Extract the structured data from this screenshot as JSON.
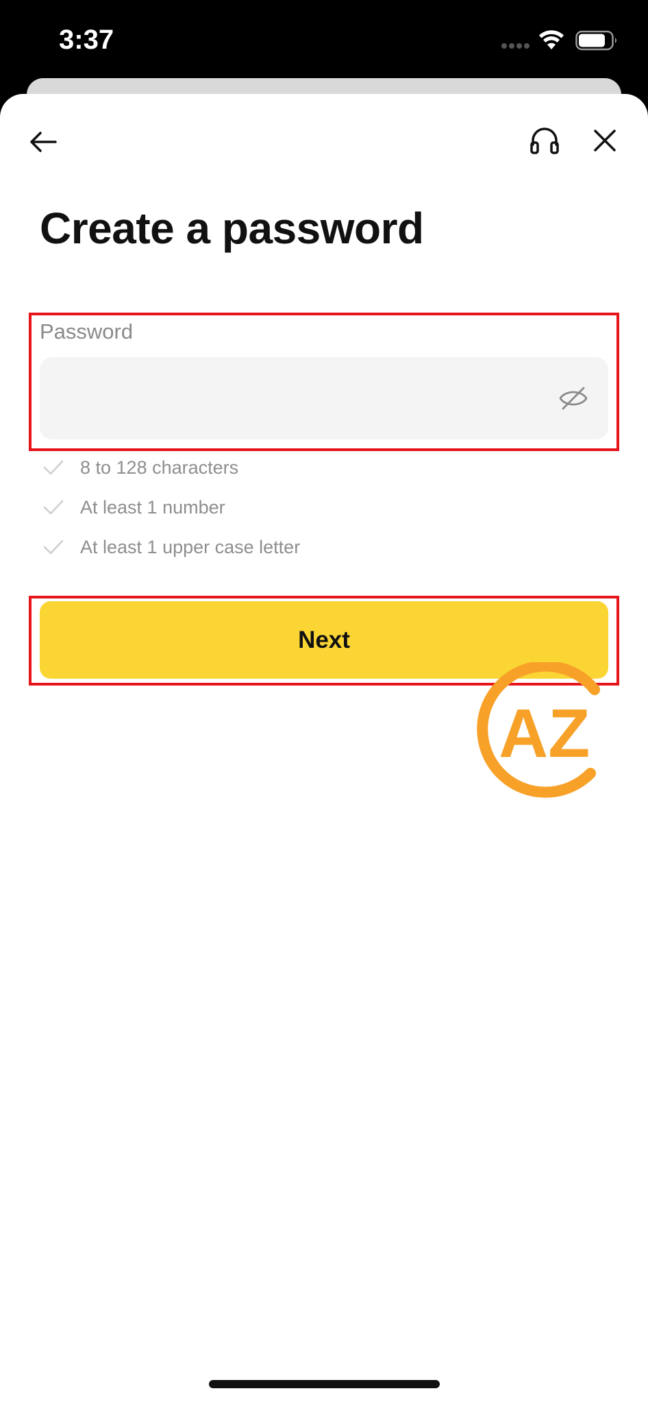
{
  "status_bar": {
    "time": "3:37"
  },
  "nav": {
    "back_icon": "arrow-left-icon",
    "support_icon": "headset-icon",
    "close_icon": "close-icon"
  },
  "title": "Create a password",
  "password_field": {
    "label": "Password",
    "value": "",
    "placeholder": "",
    "visibility_icon": "eye-off-icon"
  },
  "requirements": [
    {
      "text": "8 to 128 characters",
      "met": false
    },
    {
      "text": "At least 1 number",
      "met": false
    },
    {
      "text": "At least 1 upper case letter",
      "met": false
    }
  ],
  "next_button": {
    "label": "Next"
  },
  "watermark": {
    "text": "AZ"
  },
  "colors": {
    "accent": "#fad534",
    "highlight": "#e8141c",
    "watermark": "#f7a128"
  }
}
